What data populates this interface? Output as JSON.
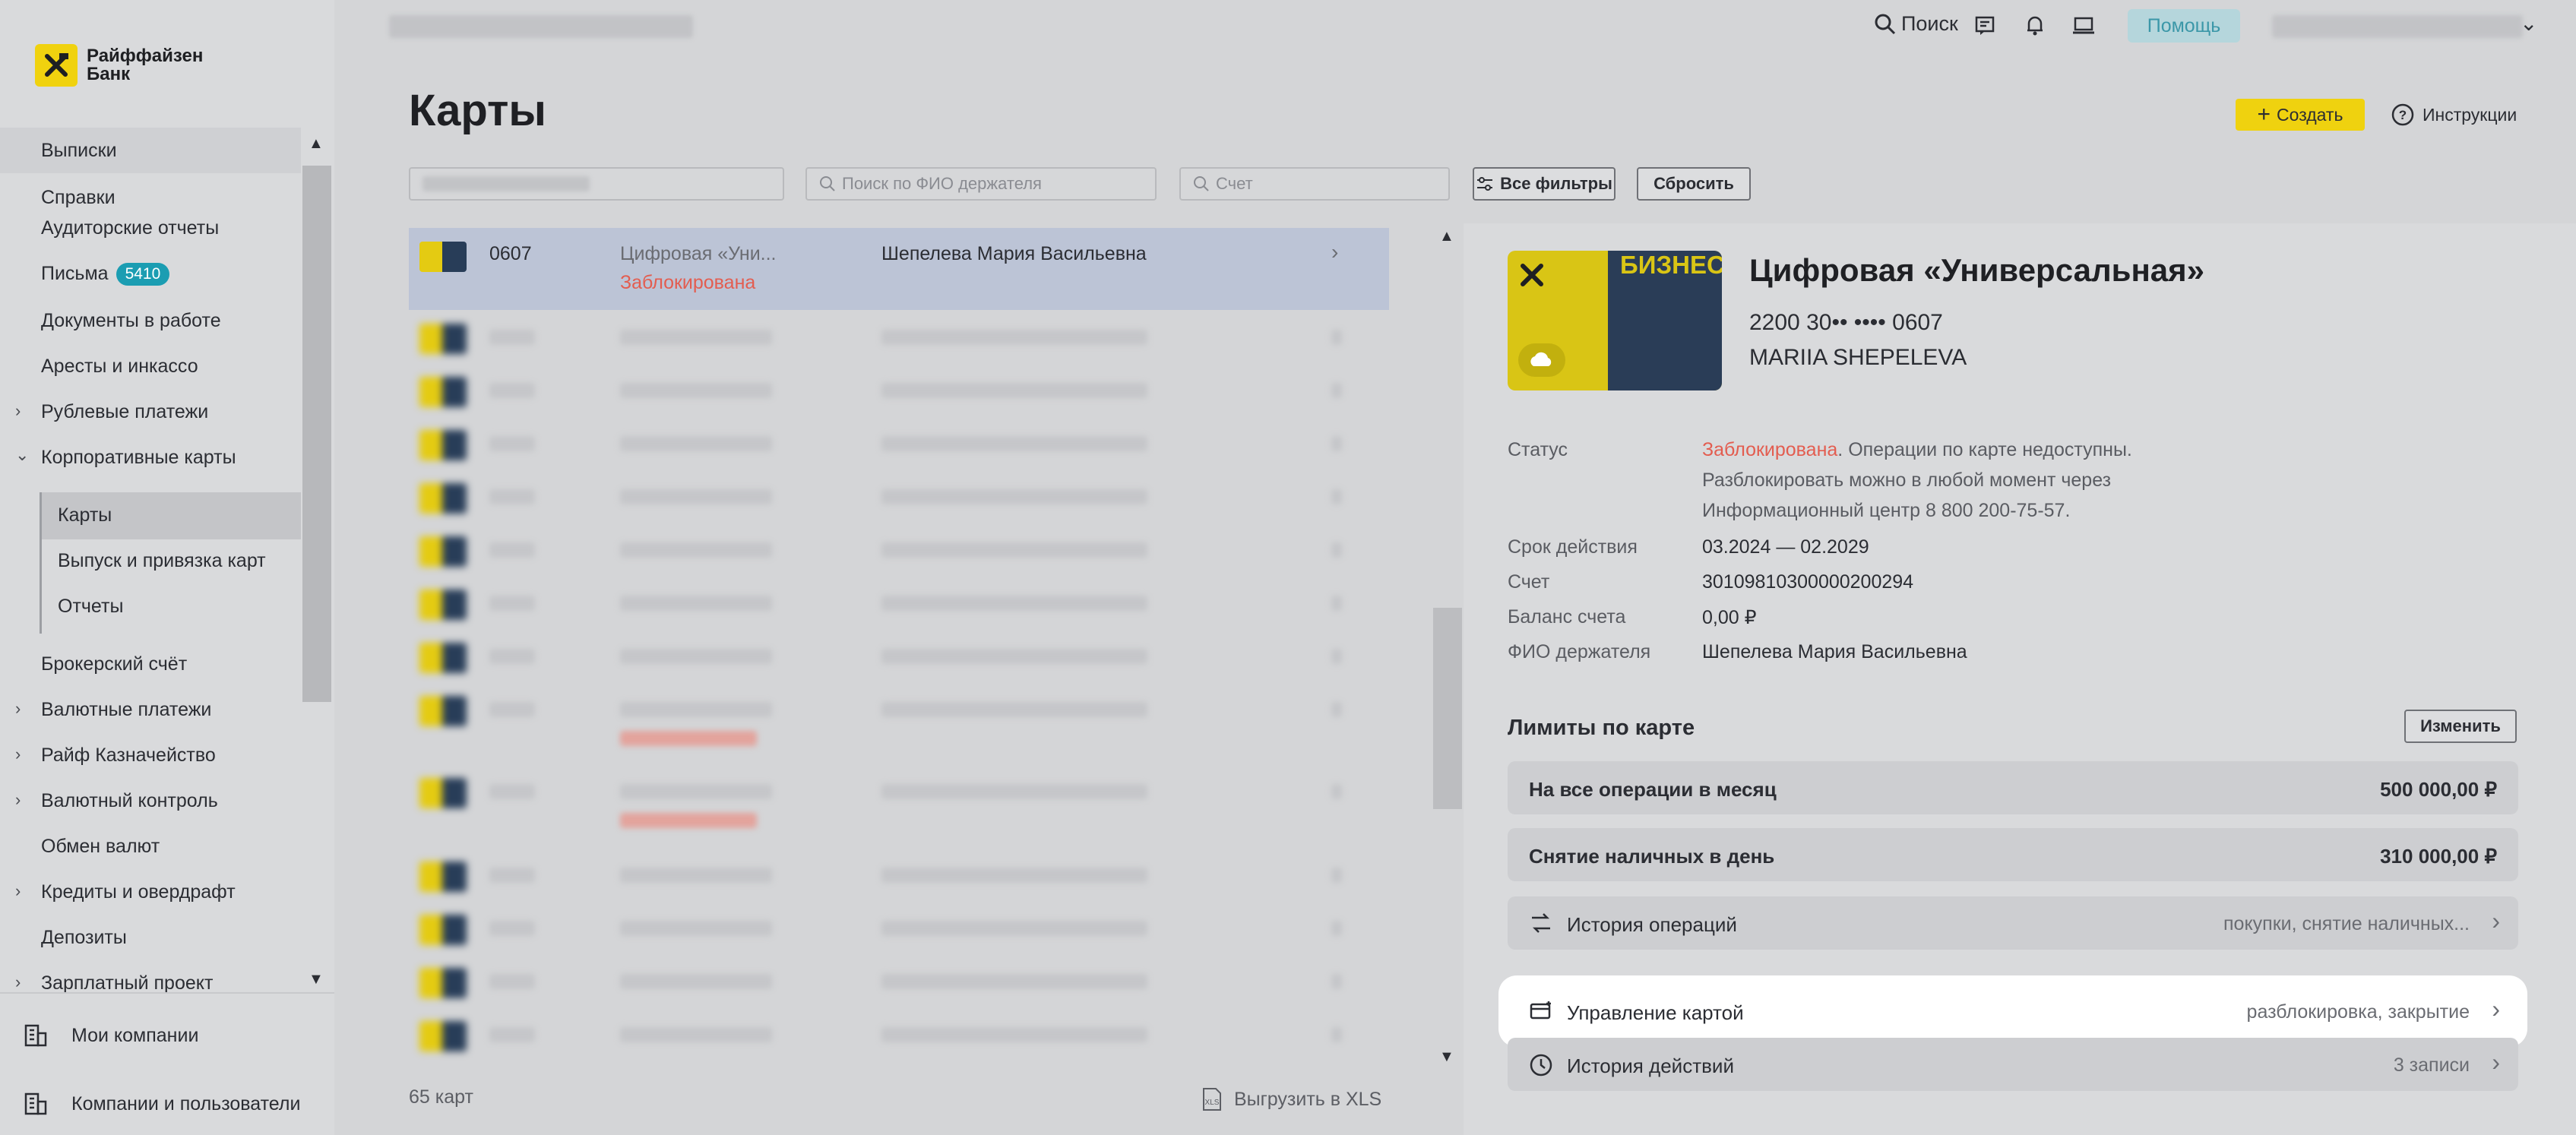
{
  "brand": {
    "name_line1": "Райффайзен",
    "name_line2": "Банк"
  },
  "sidebar": {
    "items": [
      {
        "label": "Выписки"
      },
      {
        "label": "Справки"
      },
      {
        "label": "Аудиторские отчеты"
      },
      {
        "label": "Письма",
        "badge": "5410"
      },
      {
        "label": "Документы в работе"
      },
      {
        "label": "Аресты и инкассо"
      },
      {
        "label": "Рублевые платежи"
      },
      {
        "label": "Корпоративные карты"
      },
      {
        "label": "Карты"
      },
      {
        "label": "Выпуск и привязка карт"
      },
      {
        "label": "Отчеты"
      },
      {
        "label": "Брокерский счёт"
      },
      {
        "label": "Валютные платежи"
      },
      {
        "label": "Райф Казначейство"
      },
      {
        "label": "Валютный контроль"
      },
      {
        "label": "Обмен валют"
      },
      {
        "label": "Кредиты и овердрафт"
      },
      {
        "label": "Депозиты"
      },
      {
        "label": "Зарплатный проект"
      }
    ],
    "bottom": {
      "companies": "Мои компании",
      "users": "Компании и пользователи"
    }
  },
  "topbar": {
    "search_label": "Поиск",
    "help_label": "Помощь"
  },
  "page": {
    "title": "Карты",
    "create_label": "Создать",
    "instructions_label": "Инструкции"
  },
  "filters": {
    "holder_placeholder": "Поиск по ФИО держателя",
    "account_placeholder": "Счет",
    "all_filters_label": "Все фильтры",
    "reset_label": "Сбросить"
  },
  "list": {
    "selected": {
      "number": "0607",
      "name": "Цифровая «Уни...",
      "holder": "Шепелева Мария Васильевна",
      "status": "Заблокирована"
    },
    "count_label": "65 карт",
    "export_label": "Выгрузить в XLS"
  },
  "detail": {
    "card_brand_text": "БИЗНЕС",
    "title": "Цифровая «Универсальная»",
    "number": "2200 30•• •••• 0607",
    "owner": "MARIIA SHEPELEVA",
    "labels": {
      "status": "Статус",
      "expiry": "Срок действия",
      "account": "Счет",
      "balance": "Баланс счета",
      "holder": "ФИО держателя"
    },
    "status_red": "Заблокирована",
    "status_rest": ". Операции по карте недоступны.",
    "status_line2": "Разблокировать можно в любой момент через",
    "status_line3": "Информационный центр 8 800 200-75-57.",
    "expiry": "03.2024 — 02.2029",
    "account": "30109810300000200294",
    "balance": "0,00 ₽",
    "holder": "Шепелева Мария Васильевна",
    "limits_title": "Лимиты по карте",
    "change_label": "Изменить",
    "limits": [
      {
        "label": "На все операции в месяц",
        "value": "500 000,00 ₽"
      },
      {
        "label": "Снятие наличных в день",
        "value": "310 000,00 ₽"
      }
    ],
    "actions": {
      "history_ops": {
        "label": "История операций",
        "hint": "покупки, снятие наличных..."
      },
      "manage": {
        "label": "Управление картой",
        "hint": "разблокировка, закрытие"
      },
      "history_actions": {
        "label": "История действий",
        "hint": "3 записи"
      }
    }
  }
}
